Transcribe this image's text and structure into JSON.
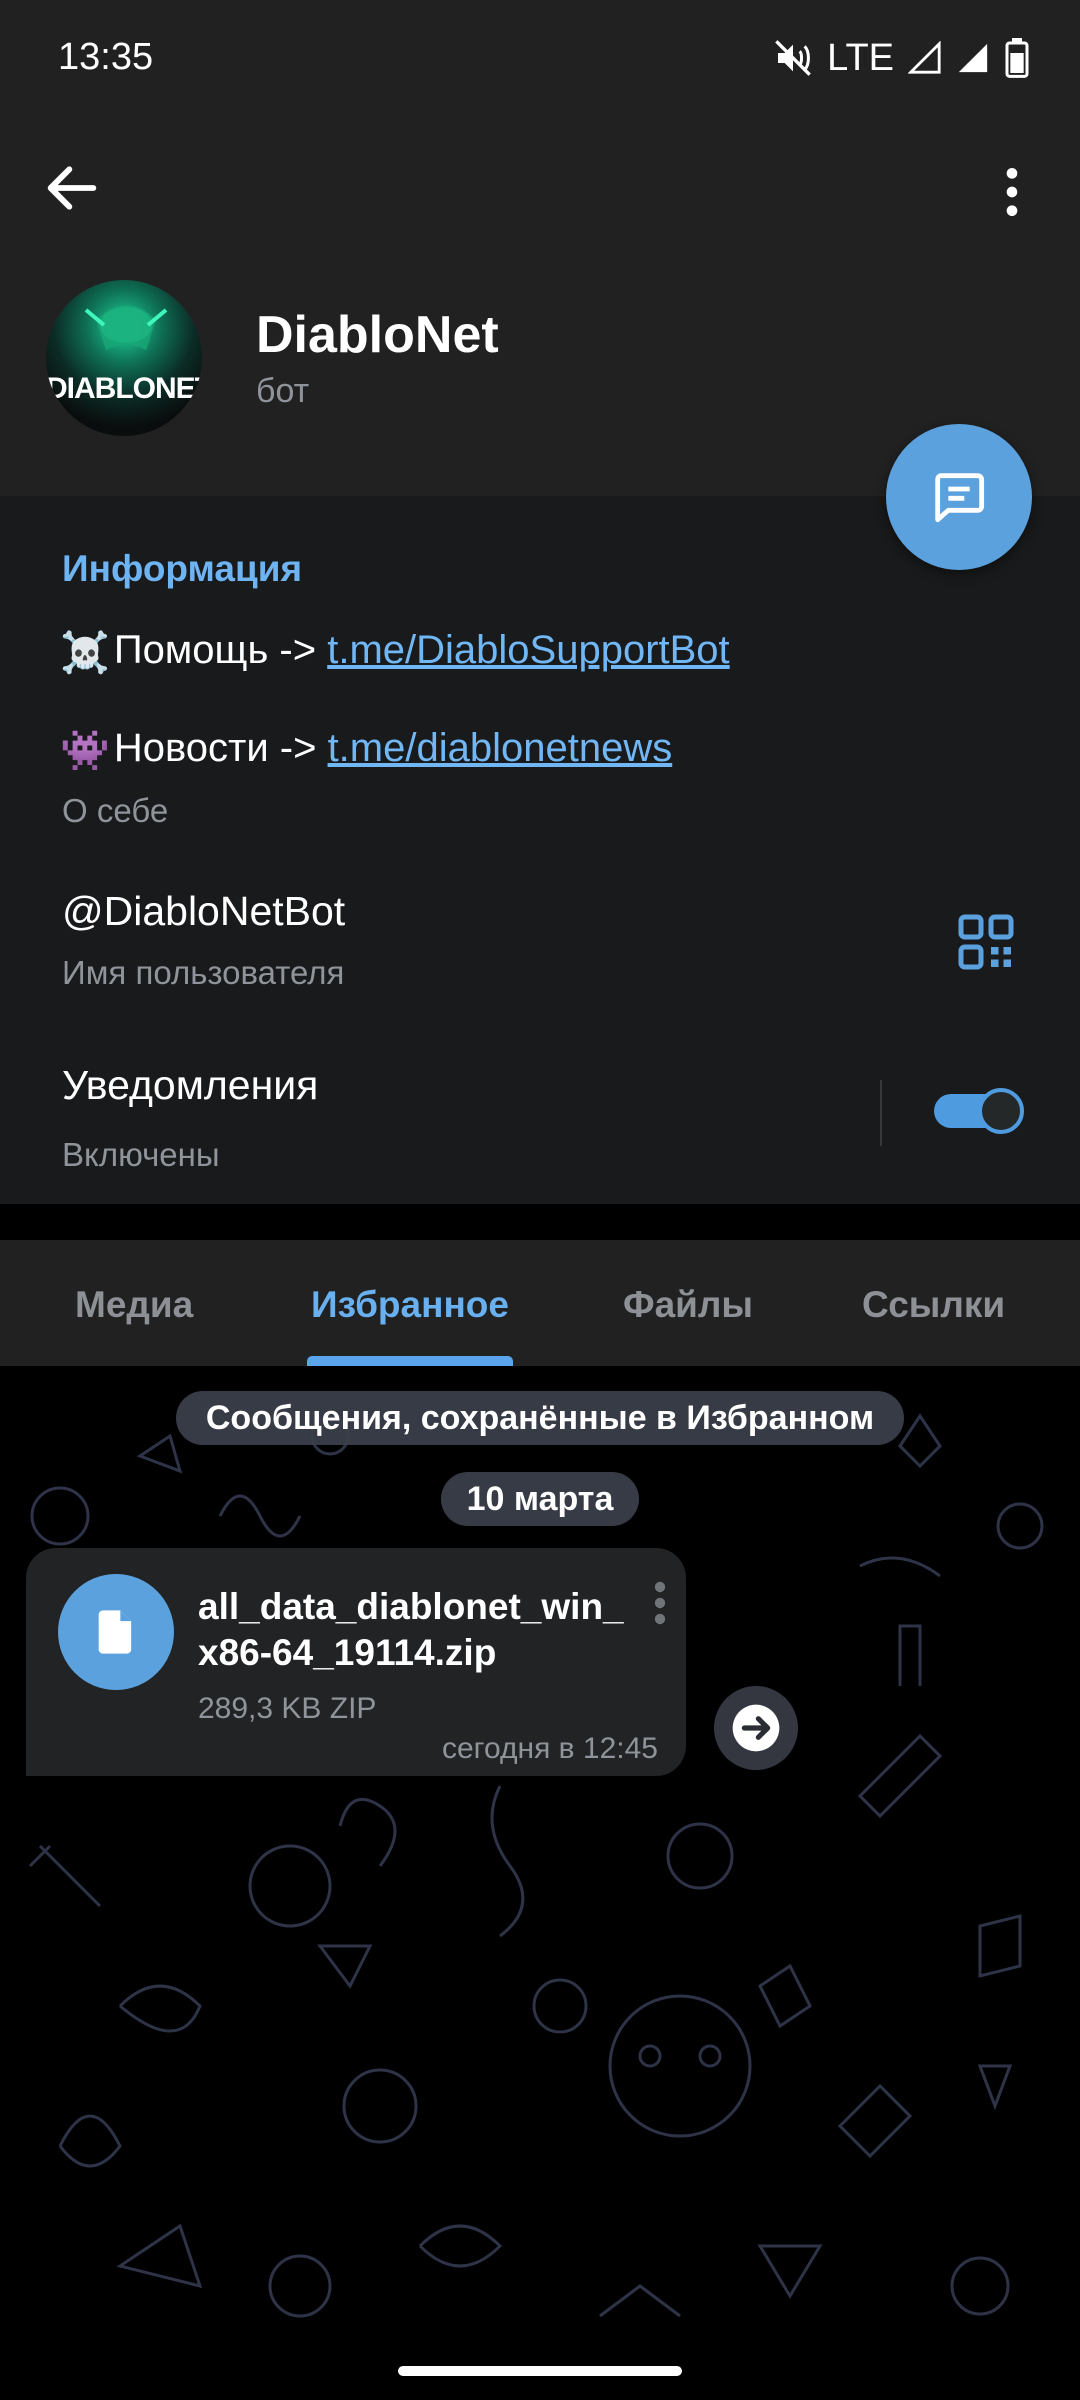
{
  "status_bar": {
    "time": "13:35",
    "network": "LTE",
    "icons": [
      "mute-icon",
      "signal-icon",
      "signal-icon",
      "battery-icon"
    ]
  },
  "header": {
    "back_icon": "arrow-left-icon",
    "more_icon": "more-vertical-icon",
    "name": "DiabloNet",
    "subtitle": "бот",
    "avatar_text": "DIABLONET",
    "fab_icon": "message-icon"
  },
  "info": {
    "title": "Информация",
    "help_prefix": "Помощь -> ",
    "help_emoji": "☠️",
    "help_link": "t.me/DiabloSupportBot",
    "news_prefix": "Новости -> ",
    "news_emoji": "👾",
    "news_link": "t.me/diablonetnews",
    "about_caption": "О себе",
    "username": "@DiabloNetBot",
    "username_caption": "Имя пользователя",
    "qr_icon": "qr-code-icon",
    "notifications_title": "Уведомления",
    "notifications_status": "Включены",
    "notifications_enabled": true
  },
  "tabs": [
    {
      "label": "Медиа",
      "active": false
    },
    {
      "label": "Избранное",
      "active": true
    },
    {
      "label": "Файлы",
      "active": false
    },
    {
      "label": "Ссылки",
      "active": false
    }
  ],
  "chat": {
    "saved_notice": "Сообщения, сохранённые в Избранном",
    "date": "10 марта",
    "file": {
      "name": "all_data_diablonet_win_x86-64_19114.zip",
      "size": "289,3 KB ZIP",
      "time": "сегодня в 12:45",
      "icon": "file-icon"
    },
    "share_icon": "share-arrow-icon"
  },
  "colors": {
    "accent": "#5aa1de",
    "link": "#72b7f5",
    "header_bg": "#212121",
    "section_bg": "#191a1b"
  }
}
